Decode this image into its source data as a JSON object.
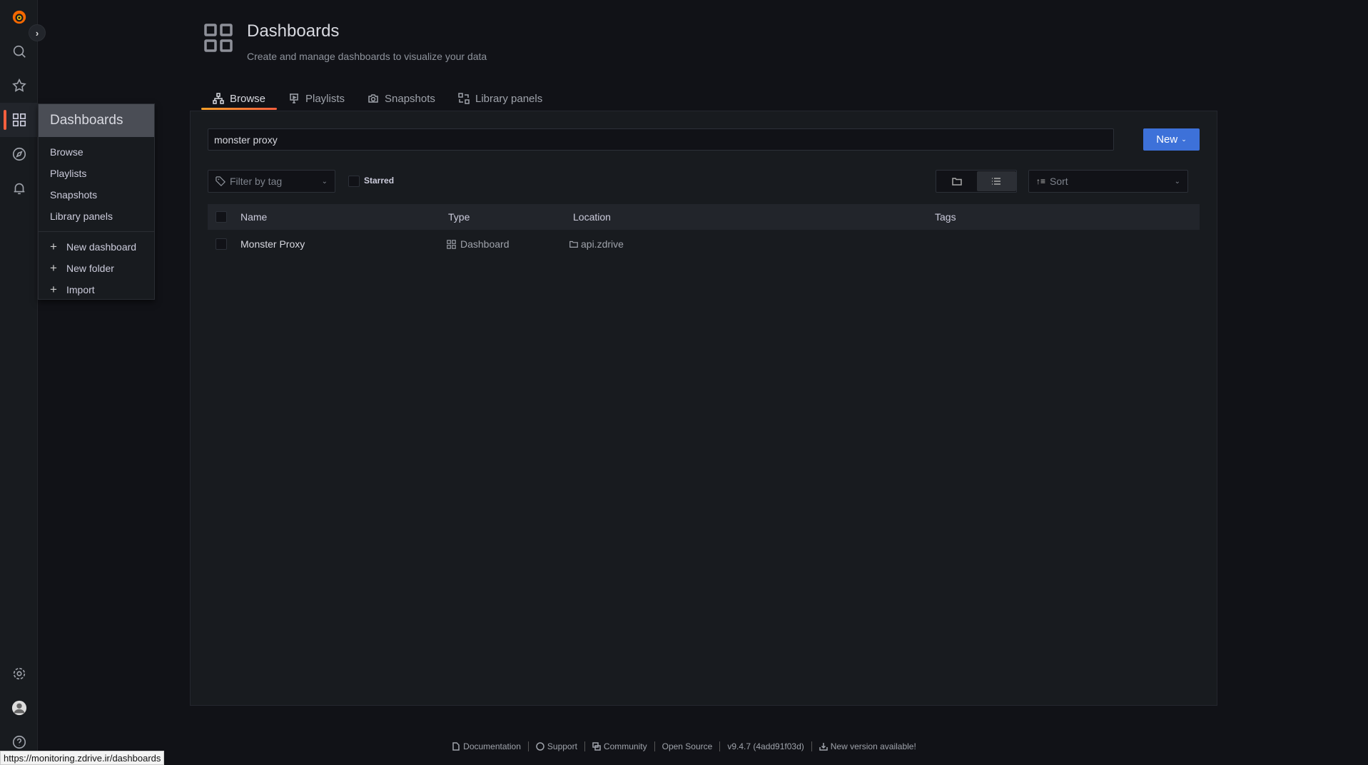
{
  "sidebar": {
    "active": "dashboards"
  },
  "menu": {
    "header": "Dashboards",
    "items": [
      {
        "label": "Browse"
      },
      {
        "label": "Playlists"
      },
      {
        "label": "Snapshots"
      },
      {
        "label": "Library panels"
      }
    ],
    "actions": [
      {
        "label": "New dashboard"
      },
      {
        "label": "New folder"
      },
      {
        "label": "Import"
      }
    ]
  },
  "page": {
    "title": "Dashboards",
    "subtitle": "Create and manage dashboards to visualize your data"
  },
  "tabs": [
    {
      "label": "Browse"
    },
    {
      "label": "Playlists"
    },
    {
      "label": "Snapshots"
    },
    {
      "label": "Library panels"
    }
  ],
  "search": {
    "value": "monster proxy"
  },
  "new_button": "New",
  "filter": {
    "placeholder": "Filter by tag",
    "starred_label": "Starred"
  },
  "sort": {
    "label": "Sort"
  },
  "table": {
    "columns": [
      "Name",
      "Type",
      "Location",
      "Tags"
    ],
    "rows": [
      {
        "name": "Monster Proxy",
        "type": "Dashboard",
        "location": "api.zdrive",
        "tags": ""
      }
    ]
  },
  "footer": {
    "documentation": "Documentation",
    "support": "Support",
    "community": "Community",
    "open_source": "Open Source",
    "version": "v9.4.7 (4add91f03d)",
    "new_version": "New version available!"
  },
  "status_url": "https://monitoring.zdrive.ir/dashboards",
  "colors": {
    "accent": "#3d71d9",
    "active": "#f55f3e"
  }
}
